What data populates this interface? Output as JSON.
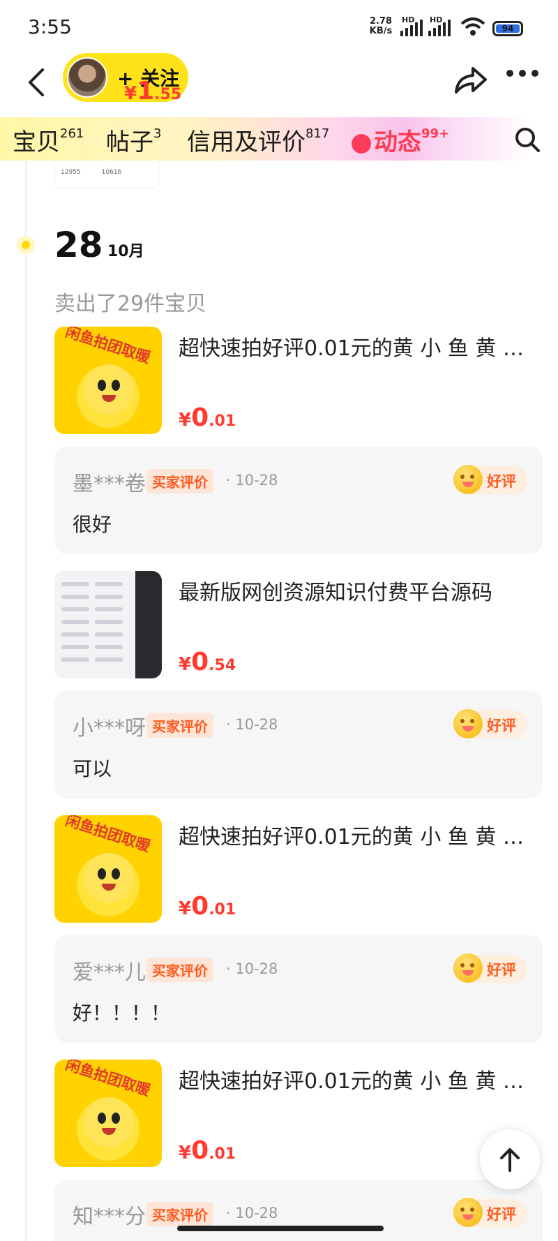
{
  "status_bar": {
    "time": "3:55",
    "net_speed_value": "2.78",
    "net_speed_unit": "KB/s",
    "hd1": "HD",
    "hd2": "HD",
    "battery": "94"
  },
  "header": {
    "follow_label": "+ 关注",
    "icons": [
      "back-icon",
      "avatar",
      "share-icon",
      "more-icon"
    ]
  },
  "tabs": [
    {
      "label": "宝贝",
      "count": "261"
    },
    {
      "label": "帖子",
      "count": "3"
    },
    {
      "label": "信用及评价",
      "count": "817"
    },
    {
      "label": "动态",
      "count": "99+"
    }
  ],
  "previous_item": {
    "price_yen": "¥",
    "price_int": "1",
    "price_dec": ".55",
    "thumb_numbers": [
      "12955",
      "10616"
    ]
  },
  "timeline": {
    "day": "28",
    "month": "10月",
    "summary": "卖出了29件宝贝"
  },
  "items": [
    {
      "title": "超快速拍好评0.01元的黄 小 鱼 黄 鱼 ...",
      "price_yen": "¥",
      "price_int": "0",
      "price_dec": ".01",
      "banner": "闲鱼拍团取暖",
      "review": {
        "reviewer": "墨***卷",
        "badge": "买家评价",
        "date": "· 10-28",
        "rating": "好评",
        "text": "很好"
      }
    },
    {
      "title": "最新版网创资源知识付费平台源码",
      "price_yen": "¥",
      "price_int": "0",
      "price_dec": ".54",
      "review": {
        "reviewer": "小***呀",
        "badge": "买家评价",
        "date": "· 10-28",
        "rating": "好评",
        "text": "可以"
      }
    },
    {
      "title": "超快速拍好评0.01元的黄 小 鱼 黄 鱼 ...",
      "price_yen": "¥",
      "price_int": "0",
      "price_dec": ".01",
      "banner": "闲鱼拍团取暖",
      "review": {
        "reviewer": "爱***儿",
        "badge": "买家评价",
        "date": "· 10-28",
        "rating": "好评",
        "text": "好！！！！"
      }
    },
    {
      "title": "超快速拍好评0.01元的黄 小 鱼 黄 鱼 ...",
      "price_yen": "¥",
      "price_int": "0",
      "price_dec": ".01",
      "banner": "闲鱼拍团取暖",
      "review": {
        "reviewer": "知***分",
        "badge": "买家评价",
        "date": "· 10-28",
        "rating": "好评",
        "text": ""
      }
    }
  ],
  "colors": {
    "accent_yellow": "#ffe219",
    "price_red": "#ff3b30",
    "badge_orange": "#ff5a1f"
  }
}
